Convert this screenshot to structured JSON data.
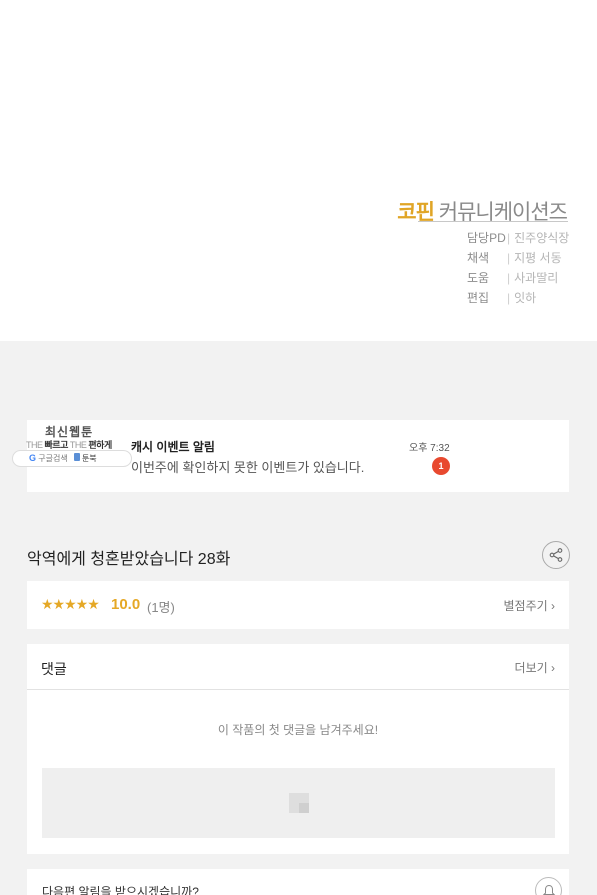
{
  "credits": {
    "company_accent": "코핀",
    "company_rest": "커뮤니케이션즈",
    "separator": "|",
    "rows": [
      {
        "role": "담당PD",
        "name": "진주양식장"
      },
      {
        "role": "채색",
        "name": "지평 서동"
      },
      {
        "role": "도움",
        "name": "사과딸리"
      },
      {
        "role": "편집",
        "name": "잇하"
      }
    ]
  },
  "brand": {
    "title": "최신웹툰",
    "tag_the1": "THE",
    "tag_fast": "빠르고",
    "tag_the2": "THE",
    "tag_easy": "편하게",
    "google_g": "G",
    "search_label": "구글검색",
    "book_name": "툰북"
  },
  "notification": {
    "title": "캐시 이벤트 알림",
    "message": "이번주에 확인하지 못한 이벤트가 있습니다.",
    "time": "오후 7:32",
    "badge": "1"
  },
  "episode": {
    "title": "악역에게 청혼받았습니다 28화"
  },
  "rating": {
    "stars": "★★★★★",
    "score": "10.0",
    "count": "(1명)",
    "rate_label": "별점주기 ›"
  },
  "comments": {
    "title": "댓글",
    "more_label": "더보기 ›",
    "empty_message": "이 작품의 첫 댓글을 남겨주세요!"
  },
  "alert": {
    "text": "다음편 알림을 받으시겠습니까?"
  },
  "colors": {
    "accent": "#e5a826",
    "badge": "#e8492f"
  }
}
